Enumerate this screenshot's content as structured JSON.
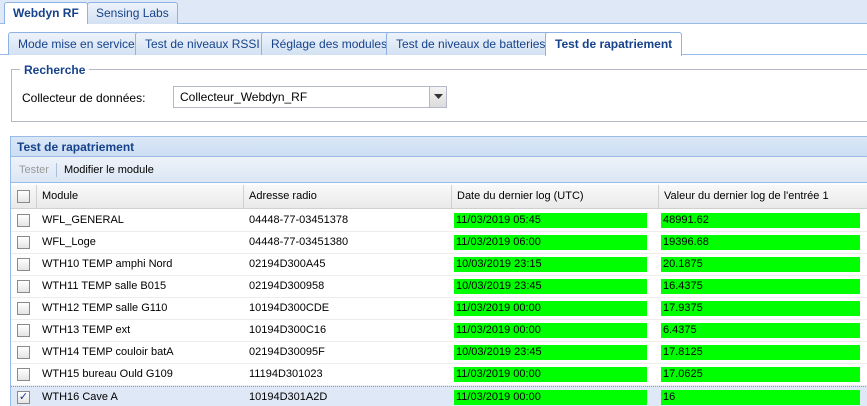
{
  "top_tabs": [
    {
      "label": "Webdyn RF",
      "active": true
    },
    {
      "label": "Sensing Labs",
      "active": false
    }
  ],
  "sub_tabs": [
    {
      "label": "Mode mise en service",
      "active": false
    },
    {
      "label": "Test de niveaux RSSI",
      "active": false
    },
    {
      "label": "Réglage des modules",
      "active": false
    },
    {
      "label": "Test de niveaux de batteries",
      "active": false
    },
    {
      "label": "Test de rapatriement",
      "active": true
    }
  ],
  "search": {
    "legend": "Recherche",
    "collector_label": "Collecteur de données:",
    "collector_value": "Collecteur_Webdyn_RF"
  },
  "panel": {
    "title": "Test de rapatriement",
    "toolbar": {
      "tester_label": "Tester",
      "modify_label": "Modifier le module"
    },
    "columns": {
      "module": "Module",
      "address": "Adresse radio",
      "date": "Date du dernier log (UTC)",
      "value": "Valeur du dernier log de l'entrée 1"
    },
    "rows": [
      {
        "module": "WFL_GENERAL",
        "address": "04448-77-03451378",
        "date": "11/03/2019 05:45",
        "value": "48991.62",
        "checked": false
      },
      {
        "module": "WFL_Loge",
        "address": "04448-77-03451380",
        "date": "11/03/2019 06:00",
        "value": "19396.68",
        "checked": false
      },
      {
        "module": "WTH10 TEMP amphi Nord",
        "address": "02194D300A45",
        "date": "10/03/2019 23:15",
        "value": "20.1875",
        "checked": false
      },
      {
        "module": "WTH11 TEMP salle B015",
        "address": "02194D300958",
        "date": "10/03/2019 23:45",
        "value": "16.4375",
        "checked": false
      },
      {
        "module": "WTH12 TEMP salle G110",
        "address": "10194D300CDE",
        "date": "11/03/2019 00:00",
        "value": "17.9375",
        "checked": false
      },
      {
        "module": "WTH13 TEMP ext",
        "address": "10194D300C16",
        "date": "11/03/2019 00:00",
        "value": "6.4375",
        "checked": false
      },
      {
        "module": "WTH14 TEMP couloir batA",
        "address": "02194D30095F",
        "date": "10/03/2019 23:45",
        "value": "17.8125",
        "checked": false
      },
      {
        "module": "WTH15 bureau Ould G109",
        "address": "11194D301023",
        "date": "11/03/2019 00:00",
        "value": "17.0625",
        "checked": false
      },
      {
        "module": "WTH16 Cave A",
        "address": "10194D301A2D",
        "date": "11/03/2019 00:00",
        "value": "16",
        "checked": true
      }
    ]
  },
  "colors": {
    "status_ok": "#00ff00",
    "accent": "#15428b"
  }
}
